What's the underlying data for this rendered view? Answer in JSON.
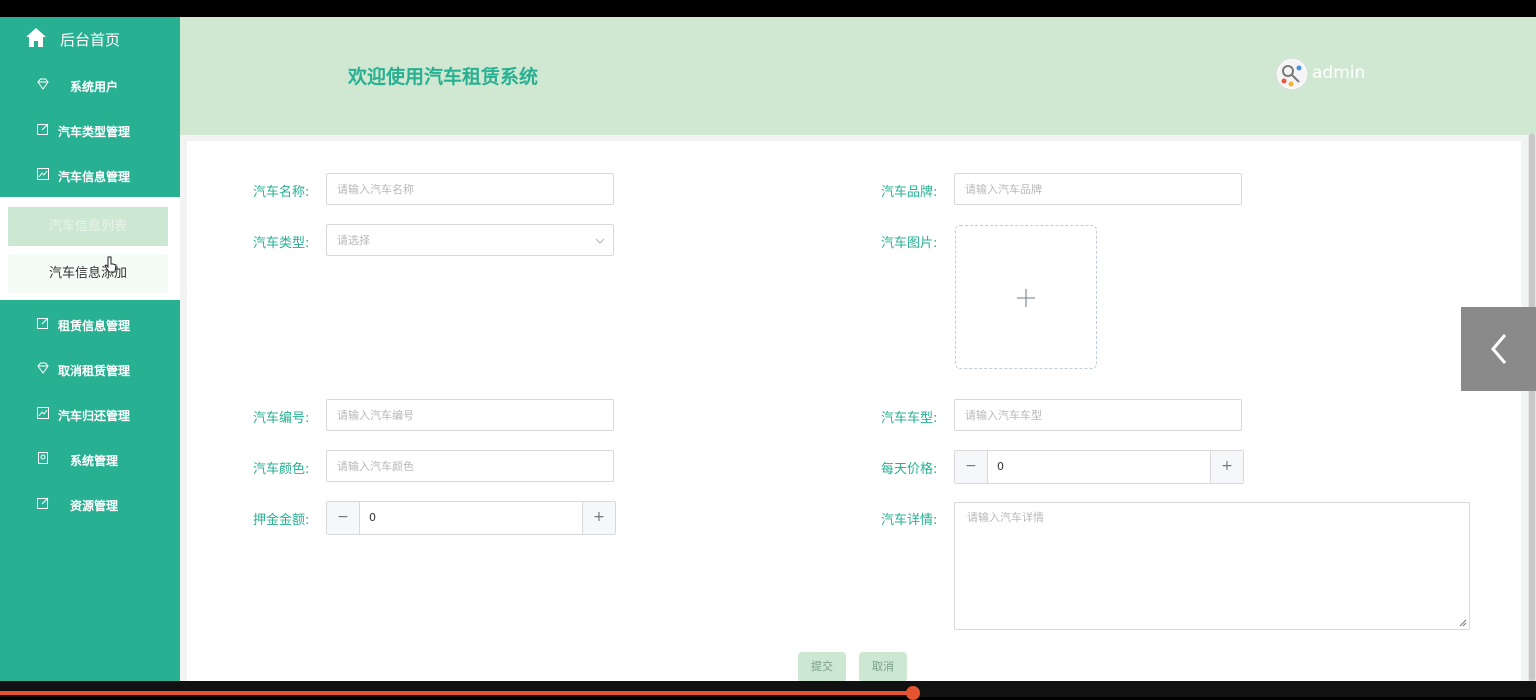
{
  "sidebar": {
    "home_label": "后台首页",
    "items": [
      {
        "label": "系统用户",
        "icon": "diamond-icon"
      },
      {
        "label": "汽车类型管理",
        "icon": "edit-icon"
      },
      {
        "label": "汽车信息管理",
        "icon": "chart-icon"
      },
      {
        "label": "租赁信息管理",
        "icon": "edit-icon"
      },
      {
        "label": "取消租赁管理",
        "icon": "diamond-icon"
      },
      {
        "label": "汽车归还管理",
        "icon": "chart-icon"
      },
      {
        "label": "系统管理",
        "icon": "bookmark-icon"
      },
      {
        "label": "资源管理",
        "icon": "edit-icon"
      }
    ],
    "submenu": [
      {
        "label": "汽车信息列表"
      },
      {
        "label": "汽车信息添加"
      }
    ]
  },
  "header": {
    "title": "欢迎使用汽车租赁系统",
    "username": "admin"
  },
  "form": {
    "car_name": {
      "label": "汽车名称:",
      "placeholder": "请输入汽车名称",
      "value": ""
    },
    "brand": {
      "label": "汽车品牌:",
      "placeholder": "请输入汽车品牌",
      "value": ""
    },
    "car_type": {
      "label": "汽车类型:",
      "placeholder": "请选择"
    },
    "image": {
      "label": "汽车图片:"
    },
    "car_no": {
      "label": "汽车编号:",
      "placeholder": "请输入汽车编号",
      "value": ""
    },
    "model": {
      "label": "汽车车型:",
      "placeholder": "请输入汽车车型",
      "value": ""
    },
    "color": {
      "label": "汽车颜色:",
      "placeholder": "请输入汽车颜色",
      "value": ""
    },
    "daily_price": {
      "label": "每天价格:",
      "value": "0"
    },
    "deposit": {
      "label": "押金金额:",
      "value": "0"
    },
    "details": {
      "label": "汽车详情:",
      "placeholder": "请输入汽车详情"
    },
    "submit_label": "提交",
    "cancel_label": "取消"
  },
  "stepper_symbols": {
    "minus": "−",
    "plus": "+"
  },
  "colors": {
    "accent": "#27b092",
    "header_bg": "#d0e8d1",
    "progress": "#e6542f"
  }
}
